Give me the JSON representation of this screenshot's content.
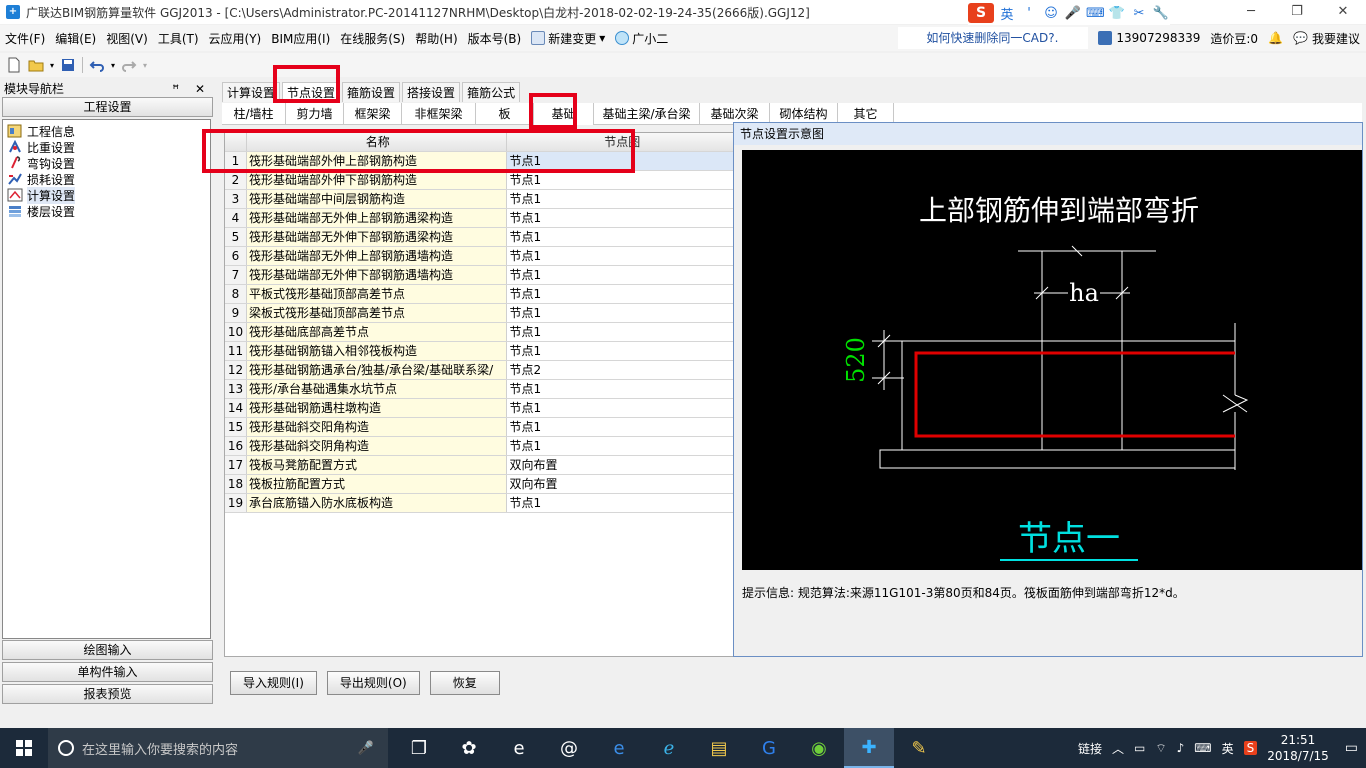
{
  "window": {
    "title": "广联达BIM钢筋算量软件 GGJ2013 - [C:\\Users\\Administrator.PC-20141127NRHM\\Desktop\\白龙村-2018-02-02-19-24-35(2666版).GGJ12]",
    "controls": [
      "─",
      "❐",
      "✕"
    ]
  },
  "ime": {
    "brand": "S",
    "lang": "英",
    "items": [
      "'",
      "☺",
      "🎤",
      "⌨",
      "👕",
      "✂",
      "🔧"
    ]
  },
  "menu": {
    "items": [
      "文件(F)",
      "编辑(E)",
      "视图(V)",
      "工具(T)",
      "云应用(Y)",
      "BIM应用(I)",
      "在线服务(S)",
      "帮助(H)",
      "版本号(B)"
    ],
    "new_change": "新建变更",
    "xiaoer": "广小二",
    "cad_link": "如何快速删除同一CAD?.",
    "phone": "13907298339",
    "price_bean": "造价豆:0",
    "suggest": "我要建议"
  },
  "nav": {
    "title": "模块导航栏",
    "header_ctrls": "ꟸ ✕",
    "section": "工程设置",
    "tree": [
      {
        "label": "工程信息",
        "icon": "info-icon"
      },
      {
        "label": "比重设置",
        "icon": "weight-icon"
      },
      {
        "label": "弯钩设置",
        "icon": "hook-icon"
      },
      {
        "label": "损耗设置",
        "icon": "loss-icon"
      },
      {
        "label": "计算设置",
        "icon": "calc-icon"
      },
      {
        "label": "楼层设置",
        "icon": "floor-icon"
      }
    ],
    "bottom": [
      "绘图输入",
      "单构件输入",
      "报表预览"
    ]
  },
  "tabs1": [
    "计算设置",
    "节点设置",
    "箍筋设置",
    "搭接设置",
    "箍筋公式"
  ],
  "tabs2": [
    "柱/墙柱",
    "剪力墙",
    "框架梁",
    "非框架梁",
    "板",
    "基础",
    "基础主梁/承台梁",
    "基础次梁",
    "砌体结构",
    "其它"
  ],
  "table": {
    "headers": [
      "名称",
      "节点图"
    ],
    "rows": [
      {
        "idx": "1",
        "name": "筏形基础端部外伸上部钢筋构造",
        "val": "节点1"
      },
      {
        "idx": "2",
        "name": "筏形基础端部外伸下部钢筋构造",
        "val": "节点1"
      },
      {
        "idx": "3",
        "name": "筏形基础端部中间层钢筋构造",
        "val": "节点1"
      },
      {
        "idx": "4",
        "name": "筏形基础端部无外伸上部钢筋遇梁构造",
        "val": "节点1"
      },
      {
        "idx": "5",
        "name": "筏形基础端部无外伸下部钢筋遇梁构造",
        "val": "节点1"
      },
      {
        "idx": "6",
        "name": "筏形基础端部无外伸上部钢筋遇墙构造",
        "val": "节点1"
      },
      {
        "idx": "7",
        "name": "筏形基础端部无外伸下部钢筋遇墙构造",
        "val": "节点1"
      },
      {
        "idx": "8",
        "name": "平板式筏形基础顶部高差节点",
        "val": "节点1"
      },
      {
        "idx": "9",
        "name": "梁板式筏形基础顶部高差节点",
        "val": "节点1"
      },
      {
        "idx": "10",
        "name": "筏形基础底部高差节点",
        "val": "节点1"
      },
      {
        "idx": "11",
        "name": "筏形基础钢筋锚入相邻筏板构造",
        "val": "节点1"
      },
      {
        "idx": "12",
        "name": "筏形基础钢筋遇承台/独基/承台梁/基础联系梁/",
        "val": "节点2"
      },
      {
        "idx": "13",
        "name": "筏形/承台基础遇集水坑节点",
        "val": "节点1"
      },
      {
        "idx": "14",
        "name": "筏形基础钢筋遇柱墩构造",
        "val": "节点1"
      },
      {
        "idx": "15",
        "name": "筏形基础斜交阳角构造",
        "val": "节点1"
      },
      {
        "idx": "16",
        "name": "筏形基础斜交阴角构造",
        "val": "节点1"
      },
      {
        "idx": "17",
        "name": "筏板马凳筋配置方式",
        "val": "双向布置"
      },
      {
        "idx": "18",
        "name": "筏板拉筋配置方式",
        "val": "双向布置"
      },
      {
        "idx": "19",
        "name": "承台底筋锚入防水底板构造",
        "val": "节点1"
      }
    ]
  },
  "diagram": {
    "panel_title": "节点设置示意图",
    "heading": "上部钢筋伸到端部弯折",
    "dim_ha": "ha",
    "dim_520": "520",
    "node_label": "节点一",
    "hint": "提示信息: 规范算法:来源11G101-3第80页和84页。筏板面筋伸到端部弯折12*d。"
  },
  "buttons": [
    "导入规则(I)",
    "导出规则(O)",
    "恢复"
  ],
  "taskbar": {
    "search_placeholder": "在这里输入你要搜索的内容",
    "tray_link": "链接",
    "tray_lang": "英",
    "time": "21:51",
    "date": "2018/7/15"
  },
  "colors": {
    "accent": "#e5001a",
    "diagram_bg": "#000000",
    "rebar": "#e00000",
    "dim": "#00e000",
    "node": "#00e0e0"
  }
}
